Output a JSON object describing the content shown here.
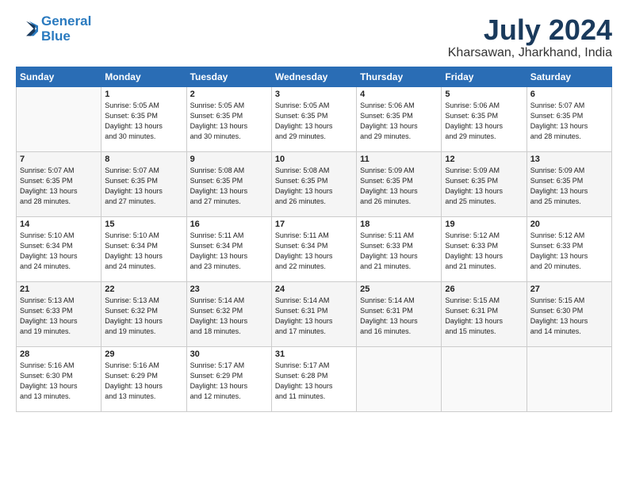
{
  "header": {
    "logo_line1": "General",
    "logo_line2": "Blue",
    "title": "July 2024",
    "subtitle": "Kharsawan, Jharkhand, India"
  },
  "calendar": {
    "weekdays": [
      "Sunday",
      "Monday",
      "Tuesday",
      "Wednesday",
      "Thursday",
      "Friday",
      "Saturday"
    ],
    "weeks": [
      [
        {
          "num": "",
          "info": ""
        },
        {
          "num": "1",
          "info": "Sunrise: 5:05 AM\nSunset: 6:35 PM\nDaylight: 13 hours\nand 30 minutes."
        },
        {
          "num": "2",
          "info": "Sunrise: 5:05 AM\nSunset: 6:35 PM\nDaylight: 13 hours\nand 30 minutes."
        },
        {
          "num": "3",
          "info": "Sunrise: 5:05 AM\nSunset: 6:35 PM\nDaylight: 13 hours\nand 29 minutes."
        },
        {
          "num": "4",
          "info": "Sunrise: 5:06 AM\nSunset: 6:35 PM\nDaylight: 13 hours\nand 29 minutes."
        },
        {
          "num": "5",
          "info": "Sunrise: 5:06 AM\nSunset: 6:35 PM\nDaylight: 13 hours\nand 29 minutes."
        },
        {
          "num": "6",
          "info": "Sunrise: 5:07 AM\nSunset: 6:35 PM\nDaylight: 13 hours\nand 28 minutes."
        }
      ],
      [
        {
          "num": "7",
          "info": "Sunrise: 5:07 AM\nSunset: 6:35 PM\nDaylight: 13 hours\nand 28 minutes."
        },
        {
          "num": "8",
          "info": "Sunrise: 5:07 AM\nSunset: 6:35 PM\nDaylight: 13 hours\nand 27 minutes."
        },
        {
          "num": "9",
          "info": "Sunrise: 5:08 AM\nSunset: 6:35 PM\nDaylight: 13 hours\nand 27 minutes."
        },
        {
          "num": "10",
          "info": "Sunrise: 5:08 AM\nSunset: 6:35 PM\nDaylight: 13 hours\nand 26 minutes."
        },
        {
          "num": "11",
          "info": "Sunrise: 5:09 AM\nSunset: 6:35 PM\nDaylight: 13 hours\nand 26 minutes."
        },
        {
          "num": "12",
          "info": "Sunrise: 5:09 AM\nSunset: 6:35 PM\nDaylight: 13 hours\nand 25 minutes."
        },
        {
          "num": "13",
          "info": "Sunrise: 5:09 AM\nSunset: 6:35 PM\nDaylight: 13 hours\nand 25 minutes."
        }
      ],
      [
        {
          "num": "14",
          "info": "Sunrise: 5:10 AM\nSunset: 6:34 PM\nDaylight: 13 hours\nand 24 minutes."
        },
        {
          "num": "15",
          "info": "Sunrise: 5:10 AM\nSunset: 6:34 PM\nDaylight: 13 hours\nand 24 minutes."
        },
        {
          "num": "16",
          "info": "Sunrise: 5:11 AM\nSunset: 6:34 PM\nDaylight: 13 hours\nand 23 minutes."
        },
        {
          "num": "17",
          "info": "Sunrise: 5:11 AM\nSunset: 6:34 PM\nDaylight: 13 hours\nand 22 minutes."
        },
        {
          "num": "18",
          "info": "Sunrise: 5:11 AM\nSunset: 6:33 PM\nDaylight: 13 hours\nand 21 minutes."
        },
        {
          "num": "19",
          "info": "Sunrise: 5:12 AM\nSunset: 6:33 PM\nDaylight: 13 hours\nand 21 minutes."
        },
        {
          "num": "20",
          "info": "Sunrise: 5:12 AM\nSunset: 6:33 PM\nDaylight: 13 hours\nand 20 minutes."
        }
      ],
      [
        {
          "num": "21",
          "info": "Sunrise: 5:13 AM\nSunset: 6:33 PM\nDaylight: 13 hours\nand 19 minutes."
        },
        {
          "num": "22",
          "info": "Sunrise: 5:13 AM\nSunset: 6:32 PM\nDaylight: 13 hours\nand 19 minutes."
        },
        {
          "num": "23",
          "info": "Sunrise: 5:14 AM\nSunset: 6:32 PM\nDaylight: 13 hours\nand 18 minutes."
        },
        {
          "num": "24",
          "info": "Sunrise: 5:14 AM\nSunset: 6:31 PM\nDaylight: 13 hours\nand 17 minutes."
        },
        {
          "num": "25",
          "info": "Sunrise: 5:14 AM\nSunset: 6:31 PM\nDaylight: 13 hours\nand 16 minutes."
        },
        {
          "num": "26",
          "info": "Sunrise: 5:15 AM\nSunset: 6:31 PM\nDaylight: 13 hours\nand 15 minutes."
        },
        {
          "num": "27",
          "info": "Sunrise: 5:15 AM\nSunset: 6:30 PM\nDaylight: 13 hours\nand 14 minutes."
        }
      ],
      [
        {
          "num": "28",
          "info": "Sunrise: 5:16 AM\nSunset: 6:30 PM\nDaylight: 13 hours\nand 13 minutes."
        },
        {
          "num": "29",
          "info": "Sunrise: 5:16 AM\nSunset: 6:29 PM\nDaylight: 13 hours\nand 13 minutes."
        },
        {
          "num": "30",
          "info": "Sunrise: 5:17 AM\nSunset: 6:29 PM\nDaylight: 13 hours\nand 12 minutes."
        },
        {
          "num": "31",
          "info": "Sunrise: 5:17 AM\nSunset: 6:28 PM\nDaylight: 13 hours\nand 11 minutes."
        },
        {
          "num": "",
          "info": ""
        },
        {
          "num": "",
          "info": ""
        },
        {
          "num": "",
          "info": ""
        }
      ]
    ]
  }
}
